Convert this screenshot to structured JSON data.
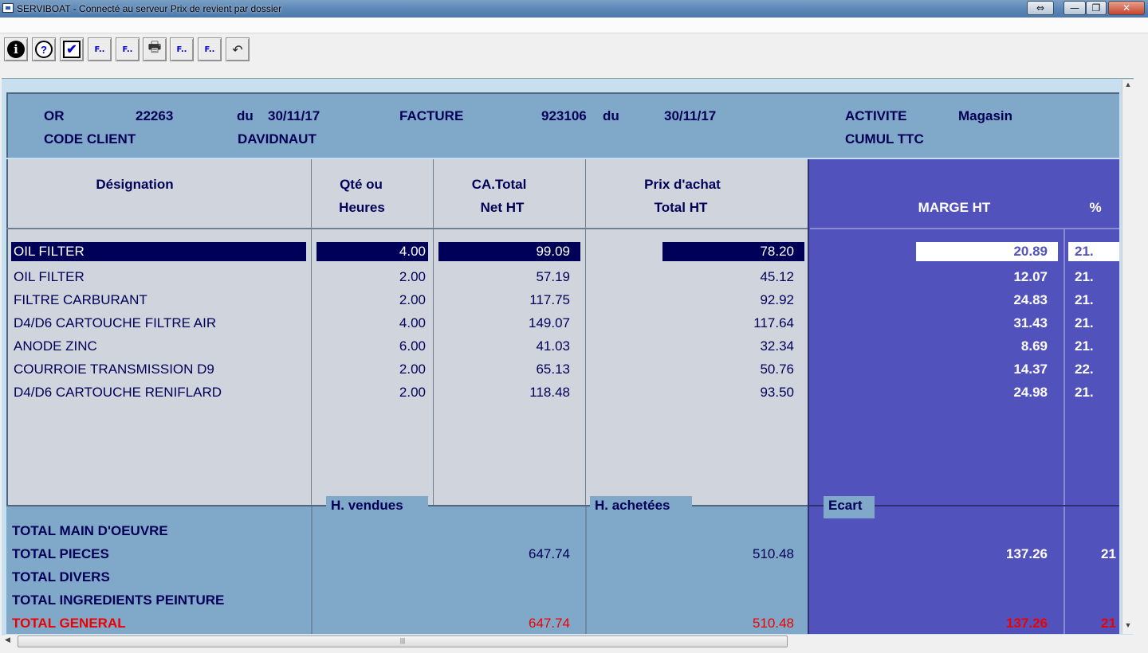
{
  "window": {
    "title": "SERVIBOAT - Connecté au serveur Prix de revient par dossier",
    "resize_glyph": "⇔",
    "min_glyph": "—",
    "max_glyph": "❐",
    "close_glyph": "✕"
  },
  "toolbar": {
    "buttons": [
      {
        "icon": "info-icon",
        "glyph": "i"
      },
      {
        "icon": "help-icon",
        "glyph": "?"
      },
      {
        "icon": "checkmark-icon",
        "glyph": "✔"
      },
      {
        "icon": "function-icon",
        "glyph": "F.."
      },
      {
        "icon": "function-icon",
        "glyph": "F.."
      },
      {
        "icon": "printer-icon",
        "glyph": "🖶"
      },
      {
        "icon": "function-icon",
        "glyph": "F.."
      },
      {
        "icon": "function-icon",
        "glyph": "F.."
      },
      {
        "icon": "exit-icon",
        "glyph": "↶"
      }
    ]
  },
  "header": {
    "or_label": "OR",
    "or_value": "22263",
    "du1_label": "du",
    "or_date": "30/11/17",
    "facture_label": "FACTURE",
    "facture_value": "923106",
    "du2_label": "du",
    "facture_date": "30/11/17",
    "activite_label": "ACTIVITE",
    "activite_value": "Magasin",
    "code_client_label": "CODE CLIENT",
    "code_client_value": "DAVIDNAUT",
    "cumul_label": "CUMUL TTC"
  },
  "columns": {
    "designation": "Désignation",
    "qte_line1": "Qté ou",
    "qte_line2": "Heures",
    "ca_line1": "CA.Total",
    "ca_line2": "Net HT",
    "pa_line1": "Prix d'achat",
    "pa_line2": "Total HT",
    "marge": "MARGE HT",
    "pct": "%"
  },
  "rows": [
    {
      "designation": "OIL FILTER",
      "qte": "4.00",
      "ca": "99.09",
      "pa": "78.20",
      "marge": "20.89",
      "pct": "21."
    },
    {
      "designation": "OIL FILTER",
      "qte": "2.00",
      "ca": "57.19",
      "pa": "45.12",
      "marge": "12.07",
      "pct": "21."
    },
    {
      "designation": "FILTRE CARBURANT",
      "qte": "2.00",
      "ca": "117.75",
      "pa": "92.92",
      "marge": "24.83",
      "pct": "21."
    },
    {
      "designation": "D4/D6 CARTOUCHE FILTRE AIR",
      "qte": "4.00",
      "ca": "149.07",
      "pa": "117.64",
      "marge": "31.43",
      "pct": "21."
    },
    {
      "designation": "ANODE ZINC",
      "qte": "6.00",
      "ca": "41.03",
      "pa": "32.34",
      "marge": "8.69",
      "pct": "21."
    },
    {
      "designation": "COURROIE TRANSMISSION D9",
      "qte": "2.00",
      "ca": "65.13",
      "pa": "50.76",
      "marge": "14.37",
      "pct": "22."
    },
    {
      "designation": "D4/D6 CARTOUCHE RENIFLARD",
      "qte": "2.00",
      "ca": "118.48",
      "pa": "93.50",
      "marge": "24.98",
      "pct": "21."
    }
  ],
  "totals": {
    "h_vendues": "H. vendues",
    "h_achetees": "H. achetées",
    "ecart": "Ecart",
    "main_oeuvre_label": "TOTAL  MAIN D'OEUVRE",
    "pieces_label": "TOTAL  PIECES",
    "pieces_ca": "647.74",
    "pieces_pa": "510.48",
    "pieces_marge": "137.26",
    "pieces_pct": "21",
    "divers_label": "TOTAL  DIVERS",
    "peinture_label": "TOTAL  INGREDIENTS PEINTURE",
    "general_label": "TOTAL  GENERAL",
    "general_ca": "647.74",
    "general_pa": "510.48",
    "general_marge": "137.26",
    "general_pct": "21"
  },
  "scroll": {
    "up": "▲",
    "down": "▼",
    "left": "◀",
    "grip": "|||"
  }
}
